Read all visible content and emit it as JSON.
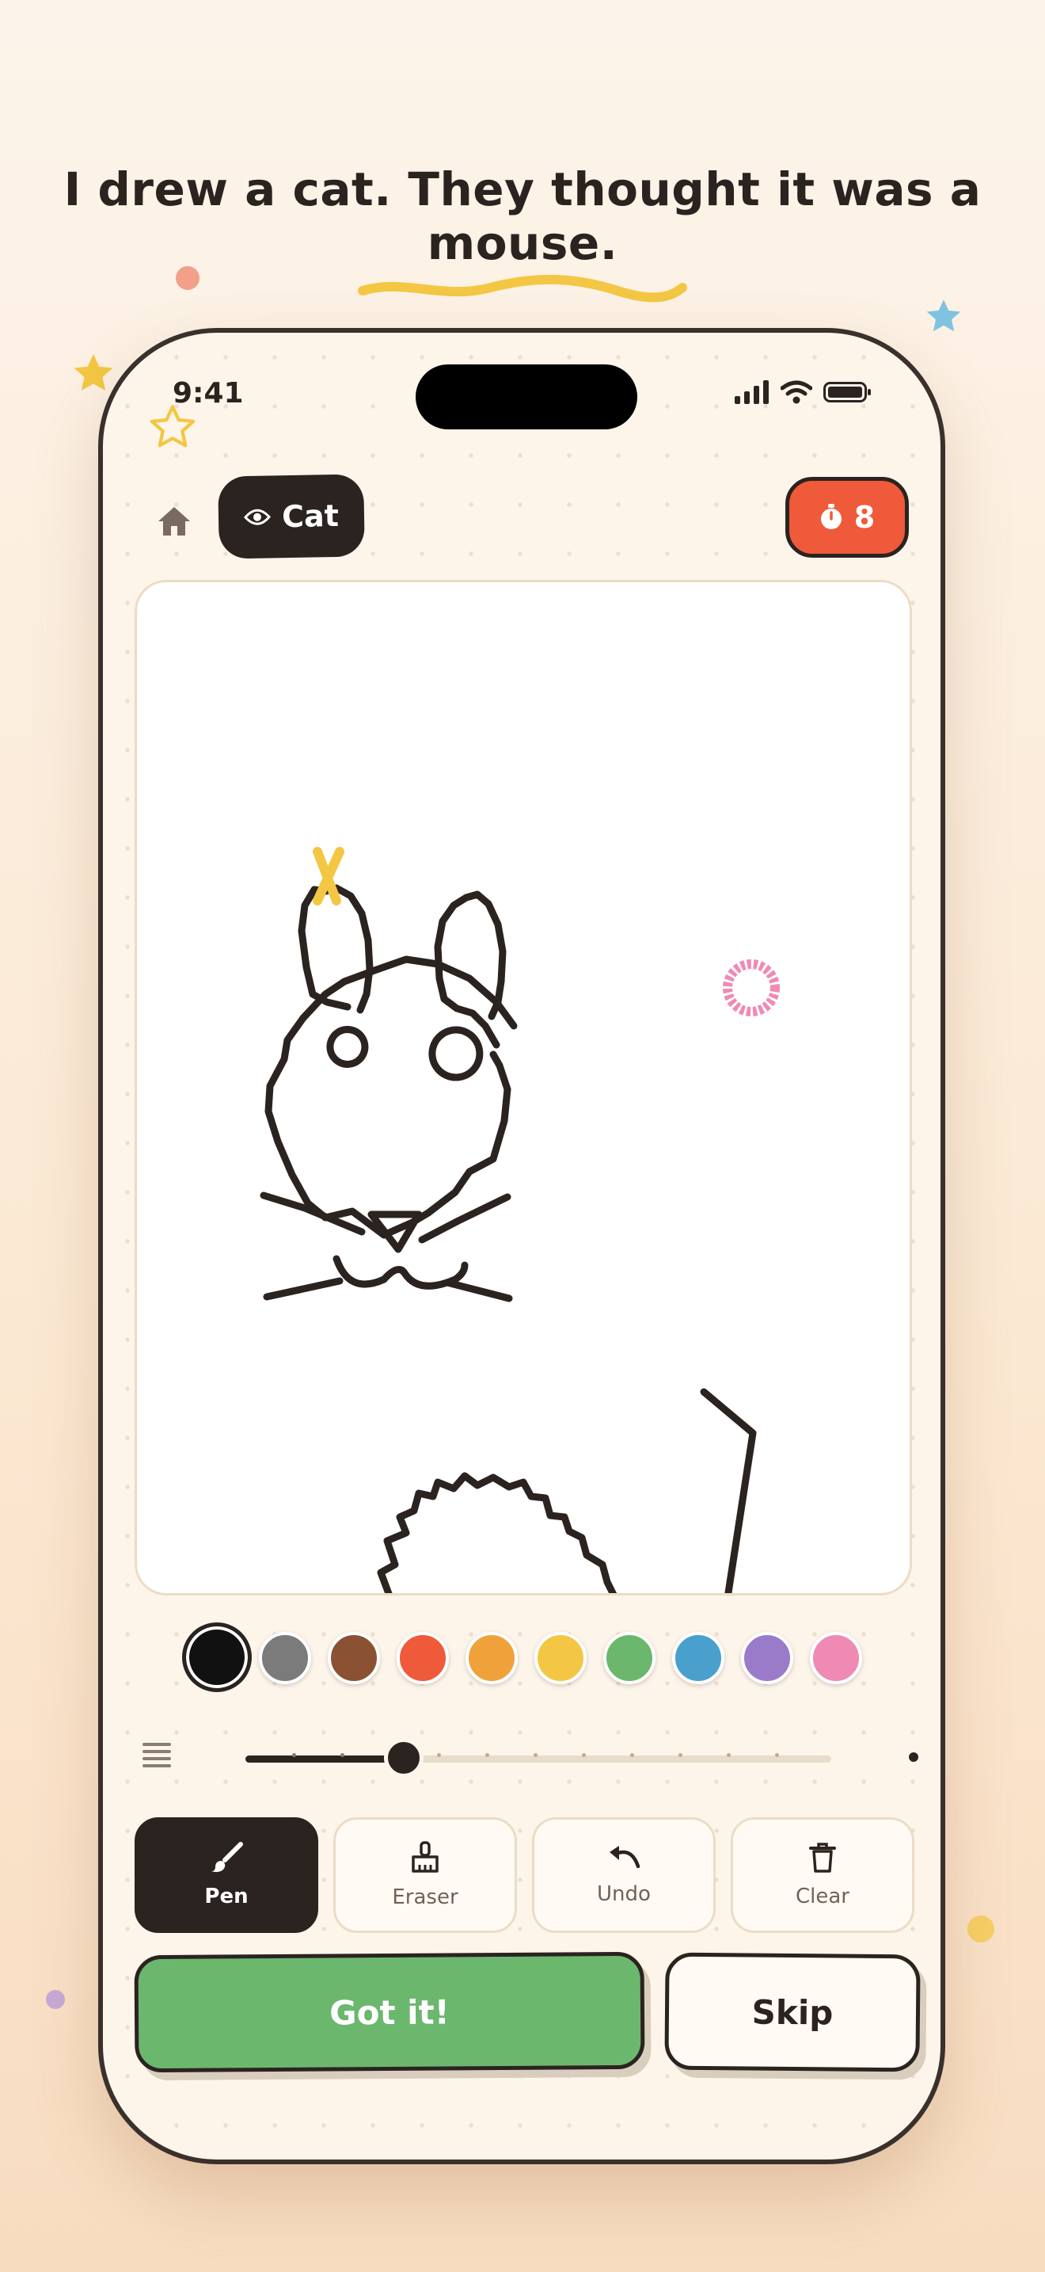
{
  "headline": "I drew a cat. They thought it was a mouse.",
  "status_bar": {
    "time": "9:41"
  },
  "header": {
    "word": "Cat",
    "timer": "8",
    "home_icon": "home-icon",
    "eye_icon": "eye-icon",
    "stopwatch_icon": "stopwatch-icon"
  },
  "palette": {
    "selected_index": 0,
    "colors": [
      "#111111",
      "#7b7b7b",
      "#8a5233",
      "#ef5a3a",
      "#f0a23a",
      "#f3c744",
      "#6cb76e",
      "#4aa0cc",
      "#9a7bc9",
      "#ef8ab4"
    ]
  },
  "brush_size": {
    "level": 0.27
  },
  "tools": {
    "pen": "Pen",
    "eraser": "Eraser",
    "undo": "Undo",
    "clear": "Clear",
    "active": "pen"
  },
  "actions": {
    "got_it": "Got it!",
    "skip": "Skip"
  },
  "colors": {
    "ink": "#2b2320",
    "accent_green": "#6cb76e",
    "accent_red": "#ef5a3a",
    "background": "#fdf5ea"
  }
}
